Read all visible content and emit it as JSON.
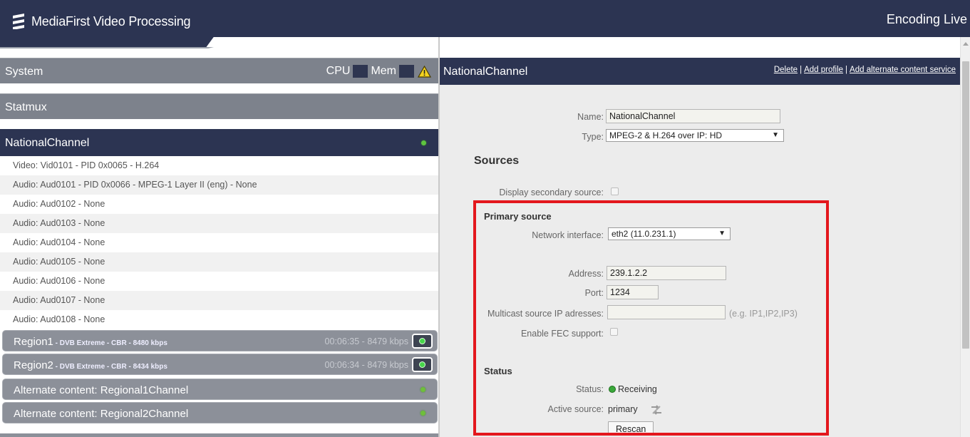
{
  "header": {
    "app_title": "MediaFirst Video Processing",
    "mode_label": "Encoding Live"
  },
  "sidebar": {
    "system_label": "System",
    "cpu_label": "CPU",
    "mem_label": "Mem",
    "statmux_label": "Statmux",
    "channel_label": "NationalChannel",
    "streams": [
      "Video: Vid0101 - PID 0x0065 - H.264",
      "Audio: Aud0101 - PID 0x0066 - MPEG-1 Layer II (eng) - None",
      "Audio: Aud0102 - None",
      "Audio: Aud0103 - None",
      "Audio: Aud0104 - None",
      "Audio: Aud0105 - None",
      "Audio: Aud0106 - None",
      "Audio: Aud0107 - None",
      "Audio: Aud0108 - None"
    ],
    "regions": [
      {
        "name": "Region1",
        "detail": " - DVB Extreme - CBR - 8480 kbps",
        "stats": "00:06:35 - 8479 kbps"
      },
      {
        "name": "Region2",
        "detail": " - DVB Extreme - CBR - 8434 kbps",
        "stats": "00:06:34 - 8479 kbps"
      }
    ],
    "alternates": [
      "Alternate content: Regional1Channel",
      "Alternate content: Regional2Channel"
    ]
  },
  "detail": {
    "title": "NationalChannel",
    "links": {
      "delete": "Delete",
      "add_profile": "Add profile",
      "add_alternate": "Add alternate content service",
      "separator": "|"
    },
    "name_label": "Name:",
    "name_value": "NationalChannel",
    "type_label": "Type:",
    "type_value": "MPEG-2 & H.264 over IP: HD",
    "sources_title": "Sources",
    "secondary_label": "Display secondary source:",
    "primary_title": "Primary source",
    "network_label": "Network interface:",
    "network_value": "eth2 (11.0.231.1)",
    "address_label": "Address:",
    "address_value": "239.1.2.2",
    "port_label": "Port:",
    "port_value": "1234",
    "multicast_label": "Multicast source IP adresses:",
    "multicast_value": "",
    "multicast_hint": "(e.g. IP1,IP2,IP3)",
    "fec_label": "Enable FEC support:",
    "status_title": "Status",
    "status_label": "Status:",
    "status_value": "Receiving",
    "active_label": "Active source:",
    "active_value": "primary",
    "rescan_label": "Rescan"
  },
  "colors": {
    "navy": "#2c3452",
    "grey_bar": "#7d828c",
    "highlight_frame": "#e3171d",
    "status_green": "#3aa83a"
  },
  "icons": [
    "ericsson-logo-icon",
    "warning-icon",
    "status-dot-icon",
    "toggle-icon",
    "swap-source-icon",
    "dropdown-arrow-icon"
  ]
}
